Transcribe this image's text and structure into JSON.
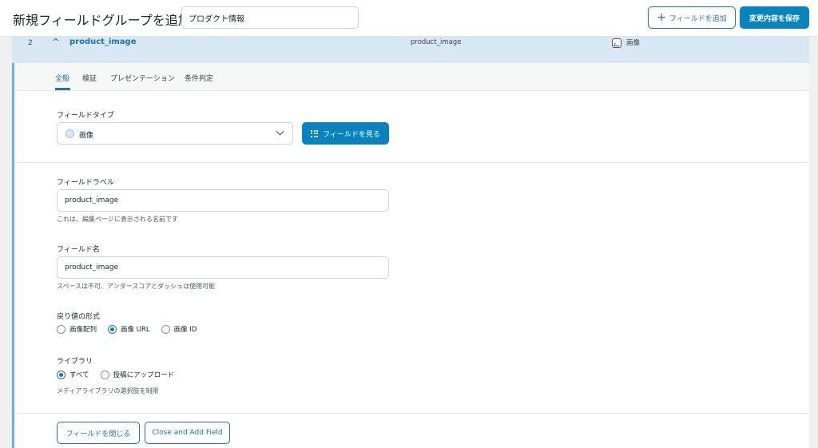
{
  "header": {
    "title": "新規フィールドグループを追加",
    "group_title_value": "プロダクト情報",
    "add_field_label": "フィールドを追加",
    "save_label": "変更内容を保存"
  },
  "field_row": {
    "order": "2",
    "label": "product_image",
    "name": "product_image",
    "type": "画像"
  },
  "tabs": [
    {
      "label": "全般",
      "active": true
    },
    {
      "label": "検証",
      "active": false
    },
    {
      "label": "プレゼンテーション",
      "active": false
    },
    {
      "label": "条件判定",
      "active": false
    }
  ],
  "field_type": {
    "label": "フィールドタイプ",
    "selected": "画像",
    "browse_label": "フィールドを見る"
  },
  "field_label": {
    "label": "フィールドラベル",
    "value": "product_image",
    "hint": "これは、編集ページに表示される名前です"
  },
  "field_name": {
    "label": "フィールド名",
    "value": "product_image",
    "hint": "スペースは不可、アンダースコアとダッシュは使用可能"
  },
  "return_format": {
    "label": "戻り値の形式",
    "options": [
      {
        "label": "画像配列",
        "checked": false
      },
      {
        "label": "画像 URL",
        "checked": true
      },
      {
        "label": "画像 ID",
        "checked": false
      }
    ]
  },
  "library": {
    "label": "ライブラリ",
    "options": [
      {
        "label": "すべて",
        "checked": true
      },
      {
        "label": "投稿にアップロード",
        "checked": false
      }
    ],
    "hint": "メディアライブラリの選択肢を制限"
  },
  "footer": {
    "close_label": "フィールドを閉じる",
    "close_add_label": "Close and Add Field"
  },
  "colors": {
    "accent": "#2271b1",
    "primary_button": "#0783be",
    "row_highlight": "#d7e7f3",
    "panel_border": "#72aee6"
  }
}
